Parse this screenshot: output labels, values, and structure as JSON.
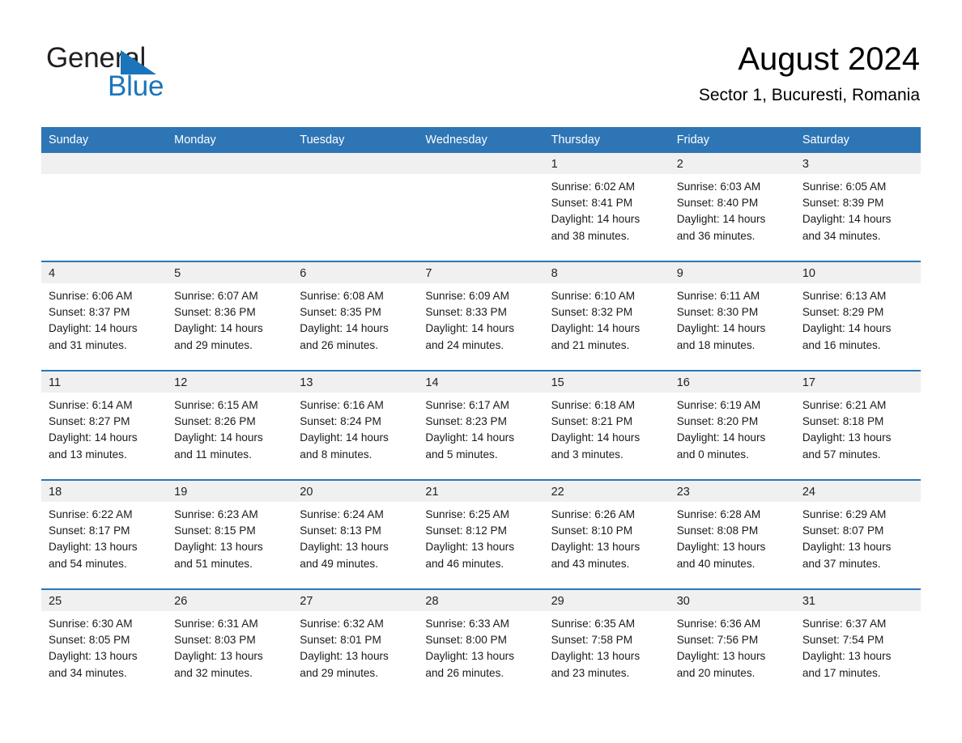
{
  "brand": {
    "name_part1": "General",
    "name_part2": "Blue",
    "accent_color": "#1b75bb",
    "logo_icon": "blue-triangle-icon"
  },
  "header": {
    "month_title": "August 2024",
    "location": "Sector 1, Bucuresti, Romania"
  },
  "theme": {
    "header_bar_color": "#2e75b6",
    "day_band_color": "#f0f0f0",
    "row_divider_color": "#2e75b6",
    "page_background": "#ffffff"
  },
  "calendar": {
    "weekday_headers": [
      "Sunday",
      "Monday",
      "Tuesday",
      "Wednesday",
      "Thursday",
      "Friday",
      "Saturday"
    ],
    "weeks": [
      [
        {
          "day": "",
          "sunrise": "",
          "sunset": "",
          "daylight_line1": "",
          "daylight_line2": "",
          "empty": true
        },
        {
          "day": "",
          "sunrise": "",
          "sunset": "",
          "daylight_line1": "",
          "daylight_line2": "",
          "empty": true
        },
        {
          "day": "",
          "sunrise": "",
          "sunset": "",
          "daylight_line1": "",
          "daylight_line2": "",
          "empty": true
        },
        {
          "day": "",
          "sunrise": "",
          "sunset": "",
          "daylight_line1": "",
          "daylight_line2": "",
          "empty": true
        },
        {
          "day": "1",
          "sunrise": "Sunrise: 6:02 AM",
          "sunset": "Sunset: 8:41 PM",
          "daylight_line1": "Daylight: 14 hours",
          "daylight_line2": "and 38 minutes."
        },
        {
          "day": "2",
          "sunrise": "Sunrise: 6:03 AM",
          "sunset": "Sunset: 8:40 PM",
          "daylight_line1": "Daylight: 14 hours",
          "daylight_line2": "and 36 minutes."
        },
        {
          "day": "3",
          "sunrise": "Sunrise: 6:05 AM",
          "sunset": "Sunset: 8:39 PM",
          "daylight_line1": "Daylight: 14 hours",
          "daylight_line2": "and 34 minutes."
        }
      ],
      [
        {
          "day": "4",
          "sunrise": "Sunrise: 6:06 AM",
          "sunset": "Sunset: 8:37 PM",
          "daylight_line1": "Daylight: 14 hours",
          "daylight_line2": "and 31 minutes."
        },
        {
          "day": "5",
          "sunrise": "Sunrise: 6:07 AM",
          "sunset": "Sunset: 8:36 PM",
          "daylight_line1": "Daylight: 14 hours",
          "daylight_line2": "and 29 minutes."
        },
        {
          "day": "6",
          "sunrise": "Sunrise: 6:08 AM",
          "sunset": "Sunset: 8:35 PM",
          "daylight_line1": "Daylight: 14 hours",
          "daylight_line2": "and 26 minutes."
        },
        {
          "day": "7",
          "sunrise": "Sunrise: 6:09 AM",
          "sunset": "Sunset: 8:33 PM",
          "daylight_line1": "Daylight: 14 hours",
          "daylight_line2": "and 24 minutes."
        },
        {
          "day": "8",
          "sunrise": "Sunrise: 6:10 AM",
          "sunset": "Sunset: 8:32 PM",
          "daylight_line1": "Daylight: 14 hours",
          "daylight_line2": "and 21 minutes."
        },
        {
          "day": "9",
          "sunrise": "Sunrise: 6:11 AM",
          "sunset": "Sunset: 8:30 PM",
          "daylight_line1": "Daylight: 14 hours",
          "daylight_line2": "and 18 minutes."
        },
        {
          "day": "10",
          "sunrise": "Sunrise: 6:13 AM",
          "sunset": "Sunset: 8:29 PM",
          "daylight_line1": "Daylight: 14 hours",
          "daylight_line2": "and 16 minutes."
        }
      ],
      [
        {
          "day": "11",
          "sunrise": "Sunrise: 6:14 AM",
          "sunset": "Sunset: 8:27 PM",
          "daylight_line1": "Daylight: 14 hours",
          "daylight_line2": "and 13 minutes."
        },
        {
          "day": "12",
          "sunrise": "Sunrise: 6:15 AM",
          "sunset": "Sunset: 8:26 PM",
          "daylight_line1": "Daylight: 14 hours",
          "daylight_line2": "and 11 minutes."
        },
        {
          "day": "13",
          "sunrise": "Sunrise: 6:16 AM",
          "sunset": "Sunset: 8:24 PM",
          "daylight_line1": "Daylight: 14 hours",
          "daylight_line2": "and 8 minutes."
        },
        {
          "day": "14",
          "sunrise": "Sunrise: 6:17 AM",
          "sunset": "Sunset: 8:23 PM",
          "daylight_line1": "Daylight: 14 hours",
          "daylight_line2": "and 5 minutes."
        },
        {
          "day": "15",
          "sunrise": "Sunrise: 6:18 AM",
          "sunset": "Sunset: 8:21 PM",
          "daylight_line1": "Daylight: 14 hours",
          "daylight_line2": "and 3 minutes."
        },
        {
          "day": "16",
          "sunrise": "Sunrise: 6:19 AM",
          "sunset": "Sunset: 8:20 PM",
          "daylight_line1": "Daylight: 14 hours",
          "daylight_line2": "and 0 minutes."
        },
        {
          "day": "17",
          "sunrise": "Sunrise: 6:21 AM",
          "sunset": "Sunset: 8:18 PM",
          "daylight_line1": "Daylight: 13 hours",
          "daylight_line2": "and 57 minutes."
        }
      ],
      [
        {
          "day": "18",
          "sunrise": "Sunrise: 6:22 AM",
          "sunset": "Sunset: 8:17 PM",
          "daylight_line1": "Daylight: 13 hours",
          "daylight_line2": "and 54 minutes."
        },
        {
          "day": "19",
          "sunrise": "Sunrise: 6:23 AM",
          "sunset": "Sunset: 8:15 PM",
          "daylight_line1": "Daylight: 13 hours",
          "daylight_line2": "and 51 minutes."
        },
        {
          "day": "20",
          "sunrise": "Sunrise: 6:24 AM",
          "sunset": "Sunset: 8:13 PM",
          "daylight_line1": "Daylight: 13 hours",
          "daylight_line2": "and 49 minutes."
        },
        {
          "day": "21",
          "sunrise": "Sunrise: 6:25 AM",
          "sunset": "Sunset: 8:12 PM",
          "daylight_line1": "Daylight: 13 hours",
          "daylight_line2": "and 46 minutes."
        },
        {
          "day": "22",
          "sunrise": "Sunrise: 6:26 AM",
          "sunset": "Sunset: 8:10 PM",
          "daylight_line1": "Daylight: 13 hours",
          "daylight_line2": "and 43 minutes."
        },
        {
          "day": "23",
          "sunrise": "Sunrise: 6:28 AM",
          "sunset": "Sunset: 8:08 PM",
          "daylight_line1": "Daylight: 13 hours",
          "daylight_line2": "and 40 minutes."
        },
        {
          "day": "24",
          "sunrise": "Sunrise: 6:29 AM",
          "sunset": "Sunset: 8:07 PM",
          "daylight_line1": "Daylight: 13 hours",
          "daylight_line2": "and 37 minutes."
        }
      ],
      [
        {
          "day": "25",
          "sunrise": "Sunrise: 6:30 AM",
          "sunset": "Sunset: 8:05 PM",
          "daylight_line1": "Daylight: 13 hours",
          "daylight_line2": "and 34 minutes."
        },
        {
          "day": "26",
          "sunrise": "Sunrise: 6:31 AM",
          "sunset": "Sunset: 8:03 PM",
          "daylight_line1": "Daylight: 13 hours",
          "daylight_line2": "and 32 minutes."
        },
        {
          "day": "27",
          "sunrise": "Sunrise: 6:32 AM",
          "sunset": "Sunset: 8:01 PM",
          "daylight_line1": "Daylight: 13 hours",
          "daylight_line2": "and 29 minutes."
        },
        {
          "day": "28",
          "sunrise": "Sunrise: 6:33 AM",
          "sunset": "Sunset: 8:00 PM",
          "daylight_line1": "Daylight: 13 hours",
          "daylight_line2": "and 26 minutes."
        },
        {
          "day": "29",
          "sunrise": "Sunrise: 6:35 AM",
          "sunset": "Sunset: 7:58 PM",
          "daylight_line1": "Daylight: 13 hours",
          "daylight_line2": "and 23 minutes."
        },
        {
          "day": "30",
          "sunrise": "Sunrise: 6:36 AM",
          "sunset": "Sunset: 7:56 PM",
          "daylight_line1": "Daylight: 13 hours",
          "daylight_line2": "and 20 minutes."
        },
        {
          "day": "31",
          "sunrise": "Sunrise: 6:37 AM",
          "sunset": "Sunset: 7:54 PM",
          "daylight_line1": "Daylight: 13 hours",
          "daylight_line2": "and 17 minutes."
        }
      ]
    ]
  }
}
